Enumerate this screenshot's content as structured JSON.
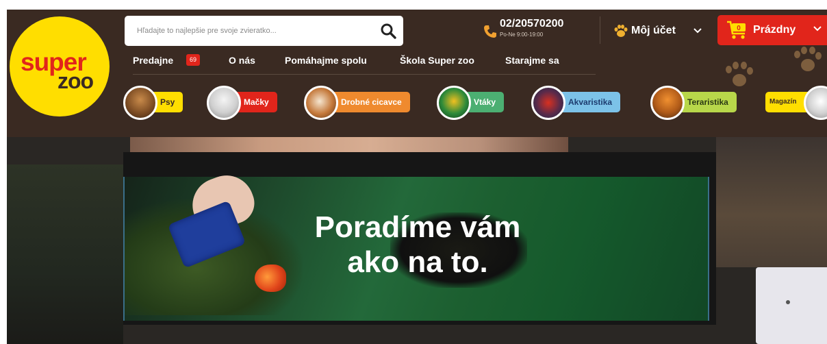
{
  "brand": {
    "logo_top": "super",
    "logo_bottom": "zoo",
    "accent": "#e1251b",
    "yellow": "#ffde00",
    "header_bg": "#3a2a22"
  },
  "search": {
    "placeholder": "Hľadajte to najlepšie pre svoje zvieratko..."
  },
  "contact": {
    "phone": "02/20570200",
    "hours": "Po-Ne 9:00-19:00"
  },
  "account": {
    "label": "Môj účet"
  },
  "cart": {
    "label": "Prázdny",
    "count": "0"
  },
  "nav": {
    "items": [
      {
        "label": "Predajne",
        "badge": "69"
      },
      {
        "label": "O nás"
      },
      {
        "label": "Pomáhajme spolu"
      },
      {
        "label": "Škola Super zoo"
      },
      {
        "label": "Starajme sa"
      }
    ]
  },
  "categories": [
    {
      "label": "Psy",
      "color": "#ffde00",
      "text": "#3a2a22"
    },
    {
      "label": "Mačky",
      "color": "#e1251b",
      "text": "#ffffff"
    },
    {
      "label": "Drobné cicavce",
      "color": "#ef8a2e",
      "text": "#ffffff"
    },
    {
      "label": "Vtáky",
      "color": "#4caf72",
      "text": "#ffffff"
    },
    {
      "label": "Akvaristika",
      "color": "#7cc2e8",
      "text": "#1d3b6e"
    },
    {
      "label": "Teraristika",
      "color": "#b8d74a",
      "text": "#2c3a14"
    },
    {
      "label": "Magazín",
      "color": "#ffde00",
      "text": "#3a2a22"
    }
  ],
  "hero": {
    "line1": "Poradíme vám",
    "line2": "ako na to."
  },
  "icons": [
    "search-icon",
    "phone-icon",
    "paw-icon",
    "chevron-down-icon",
    "cart-icon"
  ]
}
